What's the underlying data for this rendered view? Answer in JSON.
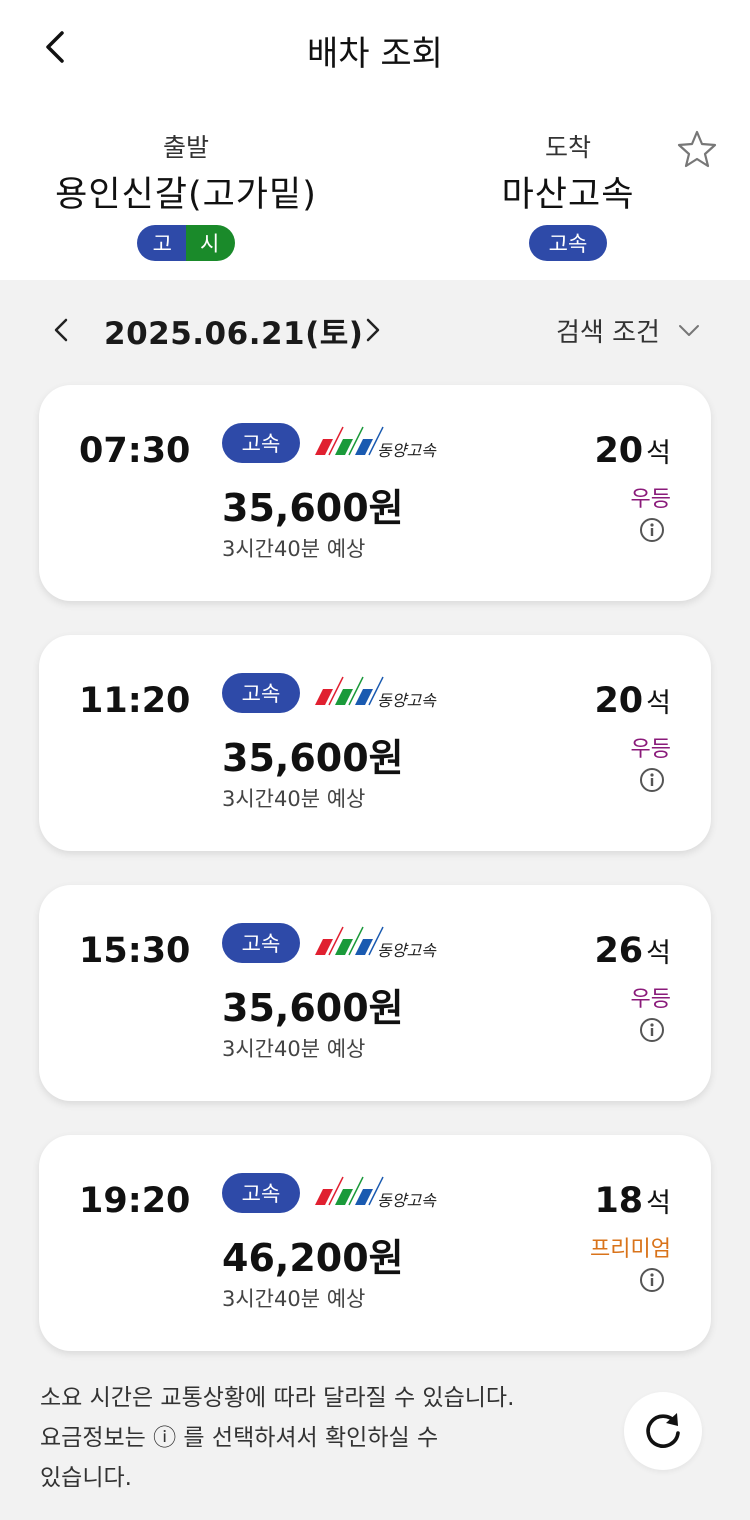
{
  "header": {
    "title": "배차 조회"
  },
  "route": {
    "departure": {
      "label": "출발",
      "name": "용인신갈(고가밑)",
      "badge_left": "고",
      "badge_right": "시"
    },
    "arrival": {
      "label": "도착",
      "name": "마산고속",
      "badge": "고속"
    }
  },
  "date_bar": {
    "date": "2025.06.21(토)",
    "search_label": "검색 조건"
  },
  "schedules": [
    {
      "time": "07:30",
      "grade": "고속",
      "company": "동양고속",
      "fare": "35,600원",
      "duration": "3시간40분 예상",
      "seats": "20",
      "seat_unit": "석",
      "class": "우등",
      "class_color": "#8a1a7a"
    },
    {
      "time": "11:20",
      "grade": "고속",
      "company": "동양고속",
      "fare": "35,600원",
      "duration": "3시간40분 예상",
      "seats": "20",
      "seat_unit": "석",
      "class": "우등",
      "class_color": "#8a1a7a"
    },
    {
      "time": "15:30",
      "grade": "고속",
      "company": "동양고속",
      "fare": "35,600원",
      "duration": "3시간40분 예상",
      "seats": "26",
      "seat_unit": "석",
      "class": "우등",
      "class_color": "#8a1a7a"
    },
    {
      "time": "19:20",
      "grade": "고속",
      "company": "동양고속",
      "fare": "46,200원",
      "duration": "3시간40분 예상",
      "seats": "18",
      "seat_unit": "석",
      "class": "프리미엄",
      "class_color": "#d9731a"
    }
  ],
  "notice": {
    "line1": "소요 시간은 교통상황에 따라 달라질 수 있습니다.",
    "line2_pre": "요금정보는 ",
    "line2_icon": "ⓘ",
    "line2_post": " 를 선택하셔서 확인하실 수",
    "line3": "있습니다."
  },
  "colors": {
    "express_blue": "#2e4aa8",
    "city_green": "#1a8a2a",
    "deluxe": "#8a1a7a",
    "premium": "#d9731a"
  },
  "icons": {
    "back": "chevron-left-icon",
    "favorite": "star-outline-icon",
    "refresh": "refresh-icon",
    "info": "info-circle-icon"
  }
}
